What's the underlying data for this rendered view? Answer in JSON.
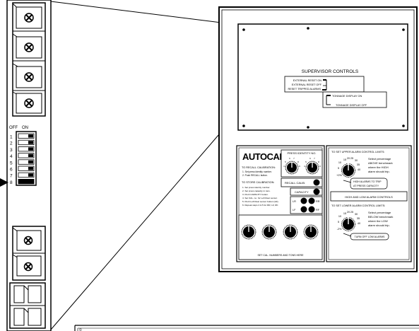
{
  "left_panel": {
    "dip_switch": {
      "off_label": "OFF",
      "on_label": "ON",
      "numbers": [
        "1",
        "2",
        "3",
        "4",
        "5",
        "6",
        "7",
        "8"
      ]
    }
  },
  "supervisor": {
    "title": "SUPERVISOR CONTROLS",
    "ext_on": "EXTERNAL RESET ON",
    "ext_off": "EXTERNAL RESET OFF",
    "reset_trip": "RESET TRIPPED ALARMS",
    "tonnage_on": "TONNAGE DISPLAY ON",
    "tonnage_off": "TONNAGE DISPLAY OFF"
  },
  "autocal": {
    "logo": "AUTOCAL",
    "recall_title": "TO RECALL CALIBRATION:",
    "recall_steps": [
      "1. Set press identity number.",
      "2. Push RECALL button."
    ],
    "store_title": "TO STORE CALIBRATION:",
    "store_steps": [
      "1. Set press identity number.",
      "2. Set press capacity in tons.",
      "3. Push CAPACITY button.",
      "4. Set CAL. no. for Left Rear sensor.",
      "5. Push Left Rear sensor button (LR).",
      "6. Repeat steps 4 & 5 for RR, LF, RF."
    ],
    "press_id": "PRESS IDENTITY NO.",
    "dial_nums": [
      "6",
      "7",
      "5",
      "8",
      "4",
      "9"
    ],
    "recall_btn": "RECALL CALIB.",
    "capacity_btn": "CAPACITY",
    "lr": "LR",
    "rr": "RR",
    "lf": "LF",
    "rf": "RF",
    "bottom_label": "SET CAL. NUMBERS AND TONS HERE"
  },
  "upper": {
    "title": "TO SET UPPER ALARM CONTROL LIMITS:",
    "scale": [
      "15",
      "20",
      "25",
      "30",
      "10",
      "35",
      "5",
      "40",
      "+2%"
    ],
    "desc": [
      "Select percentage",
      "ABOVE benchmark",
      "where the HIGH",
      "alarm should trip."
    ],
    "box": [
      "HIGH ALARMS TO TRIP",
      "AT PRESS CAPACITY"
    ]
  },
  "hl_label": "HIGH AND LOW ALARM CONTROLS",
  "lower": {
    "title": "TO SET LOWER ALARM CONTROL LIMITS:",
    "scale": [
      "15",
      "20",
      "25",
      "30",
      "10",
      "35",
      "5",
      "40",
      "-2%"
    ],
    "desc": [
      "Select percentage",
      "BELOW benchmark",
      "where the LOW",
      "alarm should trip."
    ],
    "box": "TURN OFF LOW ALARMS"
  },
  "bottom_panel_mark": "©"
}
